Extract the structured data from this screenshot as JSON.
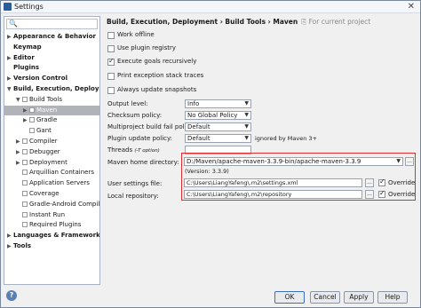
{
  "window": {
    "title": "Settings",
    "close_glyph": "✕"
  },
  "search": {
    "glyph": "🔍"
  },
  "sidebar": {
    "items": [
      {
        "label": "Appearance & Behavior",
        "arrow": "▶",
        "bold": true
      },
      {
        "label": "Keymap",
        "arrow": "",
        "bold": true
      },
      {
        "label": "Editor",
        "arrow": "▶",
        "bold": true
      },
      {
        "label": "Plugins",
        "arrow": "",
        "bold": true
      },
      {
        "label": "Version Control",
        "arrow": "▶",
        "bold": true
      },
      {
        "label": "Build, Execution, Deployment",
        "arrow": "▼",
        "bold": true
      },
      {
        "label": "Build Tools",
        "arrow": "▼",
        "bold": false
      },
      {
        "label": "Maven",
        "arrow": "▶",
        "bold": false,
        "selected": true
      },
      {
        "label": "Gradle",
        "arrow": "▶",
        "bold": false
      },
      {
        "label": "Gant",
        "arrow": "",
        "bold": false
      },
      {
        "label": "Compiler",
        "arrow": "▶",
        "bold": false
      },
      {
        "label": "Debugger",
        "arrow": "▶",
        "bold": false
      },
      {
        "label": "Deployment",
        "arrow": "▶",
        "bold": false
      },
      {
        "label": "Arquillian Containers",
        "arrow": "",
        "bold": false
      },
      {
        "label": "Application Servers",
        "arrow": "",
        "bold": false
      },
      {
        "label": "Coverage",
        "arrow": "",
        "bold": false
      },
      {
        "label": "Gradle-Android Compiler",
        "arrow": "",
        "bold": false
      },
      {
        "label": "Instant Run",
        "arrow": "",
        "bold": false
      },
      {
        "label": "Required Plugins",
        "arrow": "",
        "bold": false
      },
      {
        "label": "Languages & Frameworks",
        "arrow": "▶",
        "bold": true
      },
      {
        "label": "Tools",
        "arrow": "▶",
        "bold": true
      }
    ]
  },
  "breadcrumb": {
    "path": "Build, Execution, Deployment › Build Tools › Maven",
    "project_note": "For current project"
  },
  "options": {
    "work_offline": {
      "label": "Work offline",
      "checked": false
    },
    "use_plugin_registry": {
      "label": "Use plugin registry",
      "checked": false
    },
    "execute_goals_recursively": {
      "label": "Execute goals recursively",
      "checked": true
    },
    "print_exception_stack_traces": {
      "label": "Print exception stack traces",
      "checked": false
    },
    "always_update_snapshots": {
      "label": "Always update snapshots",
      "checked": false
    }
  },
  "fields": {
    "output_level": {
      "label": "Output level:",
      "value": "Info"
    },
    "checksum_policy": {
      "label": "Checksum policy:",
      "value": "No Global Policy"
    },
    "multiproject_build_fail_policy": {
      "label": "Multiproject build fail policy:",
      "value": "Default"
    },
    "plugin_update_policy": {
      "label": "Plugin update policy:",
      "value": "Default",
      "note": "ignored by Maven 3+"
    },
    "threads": {
      "label": "Threads",
      "hint": "(-T option)",
      "value": ""
    },
    "maven_home": {
      "label": "Maven home directory:",
      "value": "D:/Maven/apache-maven-3.3.9-bin/apache-maven-3.3.9",
      "version": "(Version: 3.3.9)"
    },
    "user_settings_file": {
      "label": "User settings file:",
      "value": "C:\\Users\\LiangYafeng\\.m2\\settings.xml",
      "override_label": "Override",
      "override_checked": true
    },
    "local_repository": {
      "label": "Local repository:",
      "value": "C:\\Users\\LiangYafeng\\.m2\\repository",
      "override_label": "Override",
      "override_checked": true
    }
  },
  "buttons": {
    "help_glyph": "?",
    "ok": "OK",
    "cancel": "Cancel",
    "apply": "Apply",
    "help": "Help",
    "dots": "...",
    "dropdown": "▼"
  }
}
